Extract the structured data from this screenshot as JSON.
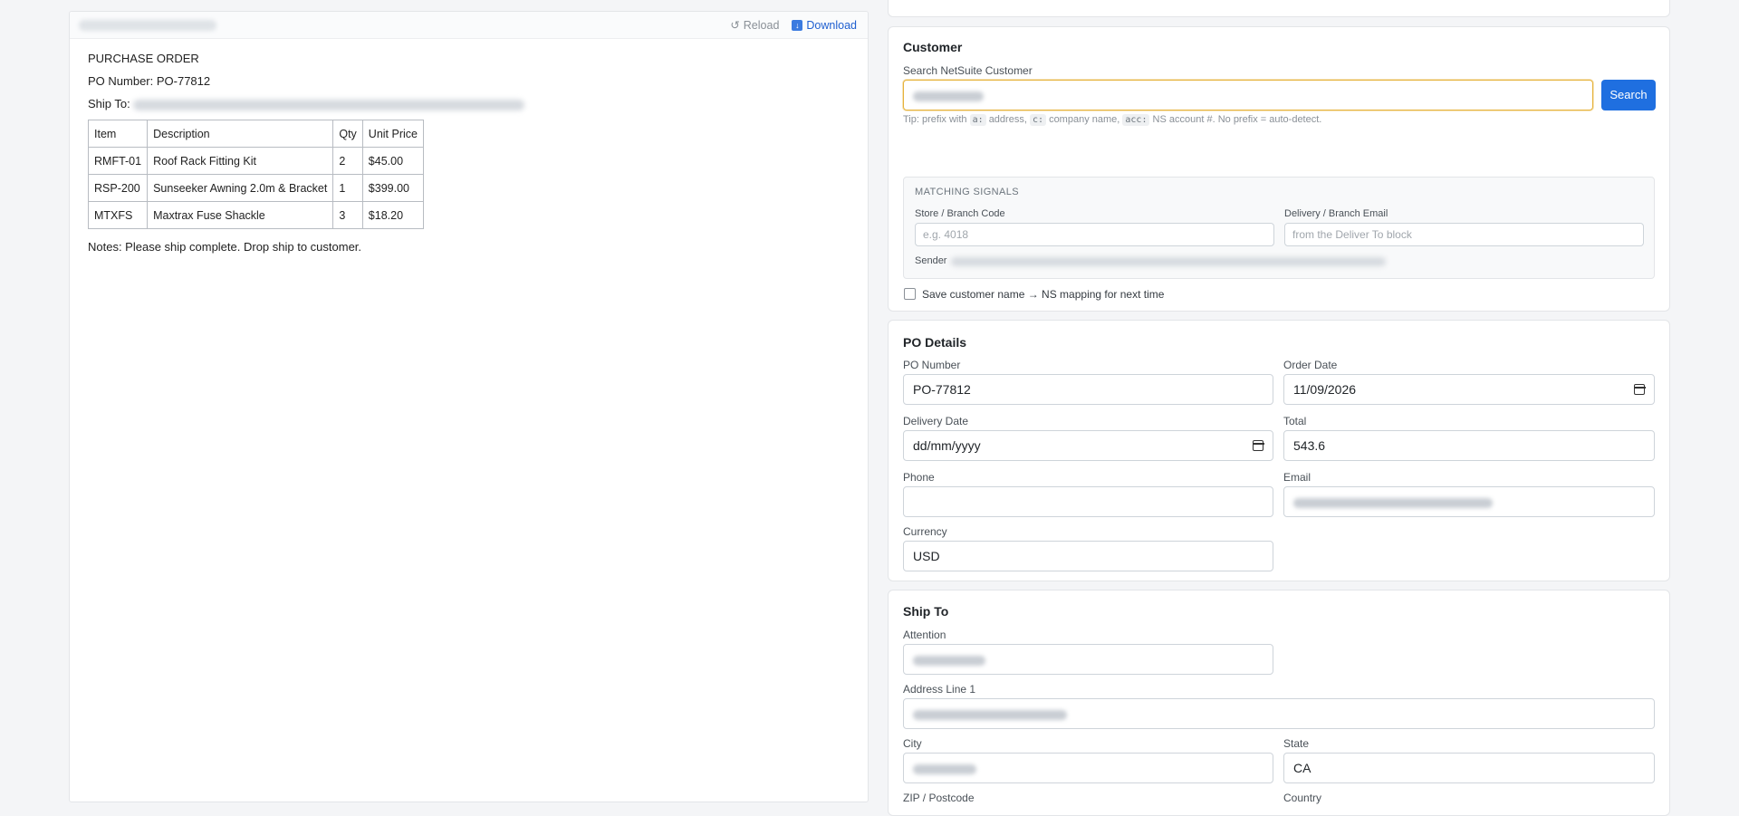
{
  "viewer": {
    "reload_label": "Reload",
    "download_label": "Download",
    "reload_icon": "reload-icon",
    "download_icon": "download-icon"
  },
  "document": {
    "heading": "PURCHASE ORDER",
    "po_line": "PO Number: PO-77812",
    "ship_to_label": "Ship To:",
    "table": {
      "headers": [
        "Item",
        "Description",
        "Qty",
        "Unit Price"
      ],
      "rows": [
        [
          "RMFT-01",
          "Roof Rack Fitting Kit",
          "2",
          "$45.00"
        ],
        [
          "RSP-200",
          "Sunseeker Awning 2.0m & Bracket",
          "1",
          "$399.00"
        ],
        [
          "MTXFS",
          "Maxtrax Fuse Shackle",
          "3",
          "$18.20"
        ]
      ]
    },
    "notes": "Notes: Please ship complete. Drop ship to customer."
  },
  "customer": {
    "title": "Customer",
    "search_label": "Search NetSuite Customer",
    "search_button": "Search",
    "tip_prefix": "Tip: prefix with",
    "tip_a": "a:",
    "tip_a_text": "address,",
    "tip_c": "c:",
    "tip_c_text": "company name,",
    "tip_acc": "acc:",
    "tip_acc_text": "NS account #. No prefix = auto-detect.",
    "signals": {
      "title": "MATCHING SIGNALS",
      "store_label": "Store / Branch Code",
      "store_placeholder": "e.g. 4018",
      "email_label": "Delivery / Branch Email",
      "email_placeholder": "from the Deliver To block",
      "sender_label": "Sender"
    },
    "save_mapping_label": "Save customer name → NS mapping for next time"
  },
  "po_details": {
    "title": "PO Details",
    "po_number_label": "PO Number",
    "po_number_value": "PO-77812",
    "order_date_label": "Order Date",
    "order_date_value": "11/09/2026",
    "delivery_date_label": "Delivery Date",
    "delivery_date_value": "dd/mm/yyyy",
    "total_label": "Total",
    "total_value": "543.6",
    "phone_label": "Phone",
    "phone_value": "",
    "email_label": "Email",
    "currency_label": "Currency",
    "currency_value": "USD"
  },
  "ship_to": {
    "title": "Ship To",
    "attention_label": "Attention",
    "address1_label": "Address Line 1",
    "city_label": "City",
    "state_label": "State",
    "state_value": "CA",
    "zip_label": "ZIP / Postcode",
    "country_label": "Country"
  }
}
